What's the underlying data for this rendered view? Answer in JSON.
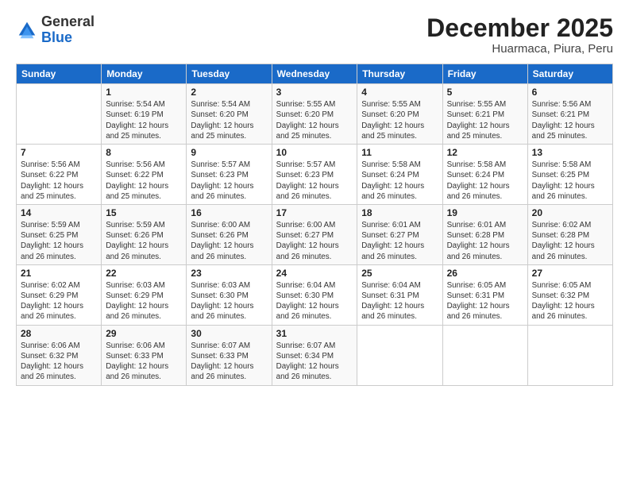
{
  "logo": {
    "general": "General",
    "blue": "Blue"
  },
  "title": "December 2025",
  "location": "Huarmaca, Piura, Peru",
  "days_of_week": [
    "Sunday",
    "Monday",
    "Tuesday",
    "Wednesday",
    "Thursday",
    "Friday",
    "Saturday"
  ],
  "weeks": [
    [
      {
        "day": "",
        "info": ""
      },
      {
        "day": "1",
        "info": "Sunrise: 5:54 AM\nSunset: 6:19 PM\nDaylight: 12 hours\nand 25 minutes."
      },
      {
        "day": "2",
        "info": "Sunrise: 5:54 AM\nSunset: 6:20 PM\nDaylight: 12 hours\nand 25 minutes."
      },
      {
        "day": "3",
        "info": "Sunrise: 5:55 AM\nSunset: 6:20 PM\nDaylight: 12 hours\nand 25 minutes."
      },
      {
        "day": "4",
        "info": "Sunrise: 5:55 AM\nSunset: 6:20 PM\nDaylight: 12 hours\nand 25 minutes."
      },
      {
        "day": "5",
        "info": "Sunrise: 5:55 AM\nSunset: 6:21 PM\nDaylight: 12 hours\nand 25 minutes."
      },
      {
        "day": "6",
        "info": "Sunrise: 5:56 AM\nSunset: 6:21 PM\nDaylight: 12 hours\nand 25 minutes."
      }
    ],
    [
      {
        "day": "7",
        "info": ""
      },
      {
        "day": "8",
        "info": "Sunrise: 5:56 AM\nSunset: 6:22 PM\nDaylight: 12 hours\nand 25 minutes."
      },
      {
        "day": "9",
        "info": "Sunrise: 5:57 AM\nSunset: 6:23 PM\nDaylight: 12 hours\nand 26 minutes."
      },
      {
        "day": "10",
        "info": "Sunrise: 5:57 AM\nSunset: 6:23 PM\nDaylight: 12 hours\nand 26 minutes."
      },
      {
        "day": "11",
        "info": "Sunrise: 5:58 AM\nSunset: 6:24 PM\nDaylight: 12 hours\nand 26 minutes."
      },
      {
        "day": "12",
        "info": "Sunrise: 5:58 AM\nSunset: 6:24 PM\nDaylight: 12 hours\nand 26 minutes."
      },
      {
        "day": "13",
        "info": "Sunrise: 5:58 AM\nSunset: 6:25 PM\nDaylight: 12 hours\nand 26 minutes."
      }
    ],
    [
      {
        "day": "14",
        "info": ""
      },
      {
        "day": "15",
        "info": "Sunrise: 5:59 AM\nSunset: 6:26 PM\nDaylight: 12 hours\nand 26 minutes."
      },
      {
        "day": "16",
        "info": "Sunrise: 6:00 AM\nSunset: 6:26 PM\nDaylight: 12 hours\nand 26 minutes."
      },
      {
        "day": "17",
        "info": "Sunrise: 6:00 AM\nSunset: 6:27 PM\nDaylight: 12 hours\nand 26 minutes."
      },
      {
        "day": "18",
        "info": "Sunrise: 6:01 AM\nSunset: 6:27 PM\nDaylight: 12 hours\nand 26 minutes."
      },
      {
        "day": "19",
        "info": "Sunrise: 6:01 AM\nSunset: 6:28 PM\nDaylight: 12 hours\nand 26 minutes."
      },
      {
        "day": "20",
        "info": "Sunrise: 6:02 AM\nSunset: 6:28 PM\nDaylight: 12 hours\nand 26 minutes."
      }
    ],
    [
      {
        "day": "21",
        "info": ""
      },
      {
        "day": "22",
        "info": "Sunrise: 6:03 AM\nSunset: 6:29 PM\nDaylight: 12 hours\nand 26 minutes."
      },
      {
        "day": "23",
        "info": "Sunrise: 6:03 AM\nSunset: 6:30 PM\nDaylight: 12 hours\nand 26 minutes."
      },
      {
        "day": "24",
        "info": "Sunrise: 6:04 AM\nSunset: 6:30 PM\nDaylight: 12 hours\nand 26 minutes."
      },
      {
        "day": "25",
        "info": "Sunrise: 6:04 AM\nSunset: 6:31 PM\nDaylight: 12 hours\nand 26 minutes."
      },
      {
        "day": "26",
        "info": "Sunrise: 6:05 AM\nSunset: 6:31 PM\nDaylight: 12 hours\nand 26 minutes."
      },
      {
        "day": "27",
        "info": "Sunrise: 6:05 AM\nSunset: 6:32 PM\nDaylight: 12 hours\nand 26 minutes."
      }
    ],
    [
      {
        "day": "28",
        "info": "Sunrise: 6:06 AM\nSunset: 6:32 PM\nDaylight: 12 hours\nand 26 minutes."
      },
      {
        "day": "29",
        "info": "Sunrise: 6:06 AM\nSunset: 6:33 PM\nDaylight: 12 hours\nand 26 minutes."
      },
      {
        "day": "30",
        "info": "Sunrise: 6:07 AM\nSunset: 6:33 PM\nDaylight: 12 hours\nand 26 minutes."
      },
      {
        "day": "31",
        "info": "Sunrise: 6:07 AM\nSunset: 6:34 PM\nDaylight: 12 hours\nand 26 minutes."
      },
      {
        "day": "",
        "info": ""
      },
      {
        "day": "",
        "info": ""
      },
      {
        "day": "",
        "info": ""
      }
    ]
  ],
  "week1_day7_info": "Sunrise: 5:56 AM\nSunset: 6:22 PM\nDaylight: 12 hours\nand 25 minutes.",
  "week3_day14_info": "Sunrise: 5:59 AM\nSunset: 6:25 PM\nDaylight: 12 hours\nand 26 minutes.",
  "week4_day21_info": "Sunrise: 6:02 AM\nSunset: 6:29 PM\nDaylight: 12 hours\nand 26 minutes."
}
